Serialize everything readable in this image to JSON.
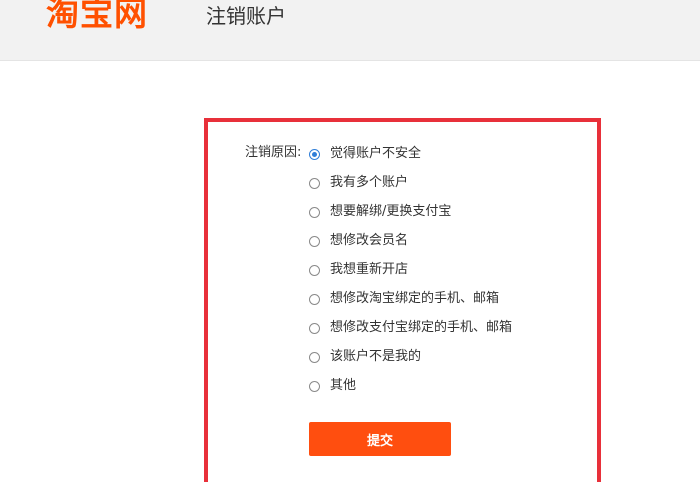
{
  "header": {
    "logo_text": "淘宝网",
    "title": "注销账户"
  },
  "form": {
    "reason_label": "注销原因:",
    "selected_index": 0,
    "options": [
      "觉得账户不安全",
      "我有多个账户",
      "想要解绑/更换支付宝",
      "想修改会员名",
      "我想重新开店",
      "想修改淘宝绑定的手机、邮箱",
      "想修改支付宝绑定的手机、邮箱",
      "该账户不是我的",
      "其他"
    ],
    "submit_label": "提交"
  },
  "colors": {
    "brand": "#ff5000",
    "panel_border": "#e8303a",
    "radio_selected": "#2f7ed8",
    "button": "#ff4e0f"
  }
}
